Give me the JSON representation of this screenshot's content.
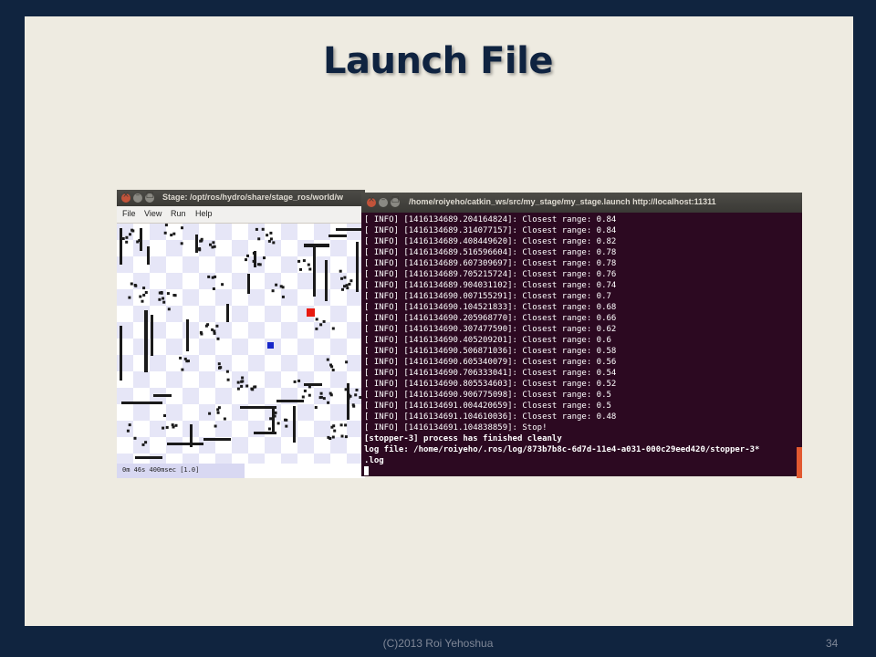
{
  "slide": {
    "title": "Launch File",
    "footer": "(C)2013 Roi Yehoshua",
    "page_number": "34"
  },
  "colors": {
    "background": "#10243f",
    "slide": "#eeebe1",
    "title": "#0f2340",
    "terminal_bg": "#2c0921",
    "robot_red": "#e8190f",
    "robot_blue": "#1727c9"
  },
  "stage_window": {
    "title": "Stage: /opt/ros/hydro/share/stage_ros/world/w",
    "menu": [
      "File",
      "View",
      "Run",
      "Help"
    ],
    "status": "0m 46s 400msec [1.0]",
    "icons": [
      "close-icon",
      "minimize-icon",
      "maximize-icon"
    ]
  },
  "terminal": {
    "title": "/home/roiyeho/catkin_ws/src/my_stage/my_stage.launch http://localhost:11311",
    "lines": [
      "[ INFO] [1416134689.204164824]: Closest range: 0.84",
      "[ INFO] [1416134689.314077157]: Closest range: 0.84",
      "[ INFO] [1416134689.408449620]: Closest range: 0.82",
      "[ INFO] [1416134689.516596604]: Closest range: 0.78",
      "[ INFO] [1416134689.607309697]: Closest range: 0.78",
      "[ INFO] [1416134689.705215724]: Closest range: 0.76",
      "[ INFO] [1416134689.904031102]: Closest range: 0.74",
      "[ INFO] [1416134690.007155291]: Closest range: 0.7",
      "[ INFO] [1416134690.104521833]: Closest range: 0.68",
      "[ INFO] [1416134690.205968770]: Closest range: 0.66",
      "[ INFO] [1416134690.307477590]: Closest range: 0.62",
      "[ INFO] [1416134690.405209201]: Closest range: 0.6",
      "[ INFO] [1416134690.506871036]: Closest range: 0.58",
      "[ INFO] [1416134690.605340079]: Closest range: 0.56",
      "[ INFO] [1416134690.706333041]: Closest range: 0.54",
      "[ INFO] [1416134690.805534603]: Closest range: 0.52",
      "[ INFO] [1416134690.906775098]: Closest range: 0.5",
      "[ INFO] [1416134691.004420659]: Closest range: 0.5",
      "[ INFO] [1416134691.104610036]: Closest range: 0.48",
      "[ INFO] [1416134691.104838859]: Stop!"
    ],
    "bold_lines": [
      "[stopper-3] process has finished cleanly",
      "log file: /home/roiyeho/.ros/log/873b7b8c-6d7d-11e4-a031-000c29eed420/stopper-3*",
      ".log"
    ],
    "icons": [
      "close-icon",
      "minimize-icon",
      "maximize-icon"
    ]
  }
}
